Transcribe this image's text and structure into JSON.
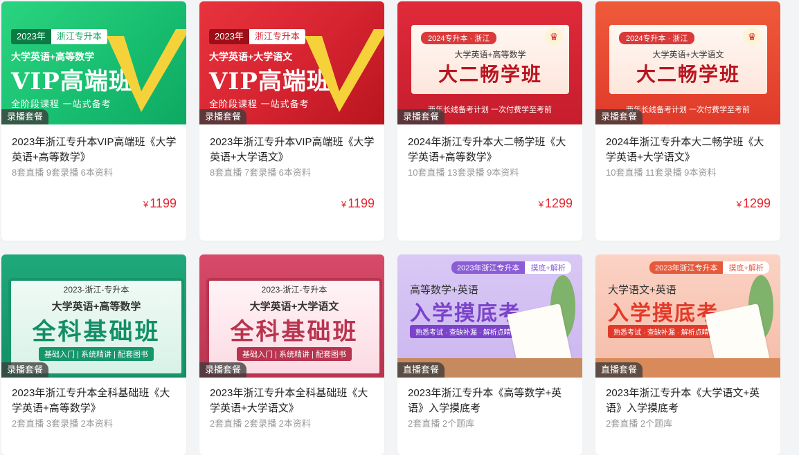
{
  "currency": "¥",
  "cards": [
    {
      "badge": "录播套餐",
      "title": "2023年浙江专升本VIP高端班《大学英语+高等数学》",
      "meta": "8套直播 9套录播 6本资料",
      "price": "1199",
      "cover": {
        "tag_year": "2023年",
        "tag_place": "浙江专升本",
        "subtitle": "大学英语+高等数学",
        "main": "VIP高端班",
        "footer": "全阶段课程 一站式备考"
      }
    },
    {
      "badge": "录播套餐",
      "title": "2023年浙江专升本VIP高端班《大学英语+大学语文》",
      "meta": "8套直播 7套录播 6本资料",
      "price": "1199",
      "cover": {
        "tag_year": "2023年",
        "tag_place": "浙江专升本",
        "subtitle": "大学英语+大学语文",
        "main": "VIP高端班",
        "footer": "全阶段课程 一站式备考"
      }
    },
    {
      "badge": "录播套餐",
      "title": "2024年浙江专升本大二畅学班《大学英语+高等数学》",
      "meta": "10套直播 13套录播 9本资料",
      "price": "1299",
      "cover": {
        "tag": "2024专升本 · 浙江",
        "subtitle": "大学英语+高等数学",
        "main": "大二畅学班",
        "footer": "两年长线备考计划 一次付费学至考前"
      }
    },
    {
      "badge": "录播套餐",
      "title": "2024年浙江专升本大二畅学班《大学英语+大学语文》",
      "meta": "10套直播 11套录播 9本资料",
      "price": "1299",
      "cover": {
        "tag": "2024专升本 · 浙江",
        "subtitle": "大学英语+大学语文",
        "main": "大二畅学班",
        "footer": "两年长线备考计划 一次付费学至考前"
      }
    },
    {
      "badge": "录播套餐",
      "title": "2023年浙江专升本全科基础班《大学英语+高等数学》",
      "meta": "2套直播 3套录播 2本资料",
      "cover": {
        "tag": "2023-浙江-专升本",
        "subtitle": "大学英语+高等数学",
        "main": "全科基础班",
        "footer": "基础入门 | 系统精讲 | 配套图书"
      }
    },
    {
      "badge": "录播套餐",
      "title": "2023年浙江专升本全科基础班《大学英语+大学语文》",
      "meta": "2套直播 2套录播 2本资料",
      "cover": {
        "tag": "2023-浙江-专升本",
        "subtitle": "大学英语+大学语文",
        "main": "全科基础班",
        "footer": "基础入门 | 系统精讲 | 配套图书"
      }
    },
    {
      "badge": "直播套餐",
      "title": "2023年浙江专升本《高等数学+英语》入学摸底考",
      "meta": "2套直播 2个题库",
      "cover": {
        "tag_year": "2023年浙江专升本",
        "tag_type": "摸底+解析",
        "subtitle": "高等数学+英语",
        "main": "入学摸底考",
        "footer": "熟悉考试 · 查缺补漏 · 解析点睛"
      }
    },
    {
      "badge": "直播套餐",
      "title": "2023年浙江专升本《大学语文+英语》入学摸底考",
      "meta": "2套直播 2个题库",
      "cover": {
        "tag_year": "2023年浙江专升本",
        "tag_type": "摸底+解析",
        "subtitle": "大学语文+英语",
        "main": "入学摸底考",
        "footer": "熟悉考试 · 查缺补漏 · 解析点睛"
      }
    }
  ]
}
